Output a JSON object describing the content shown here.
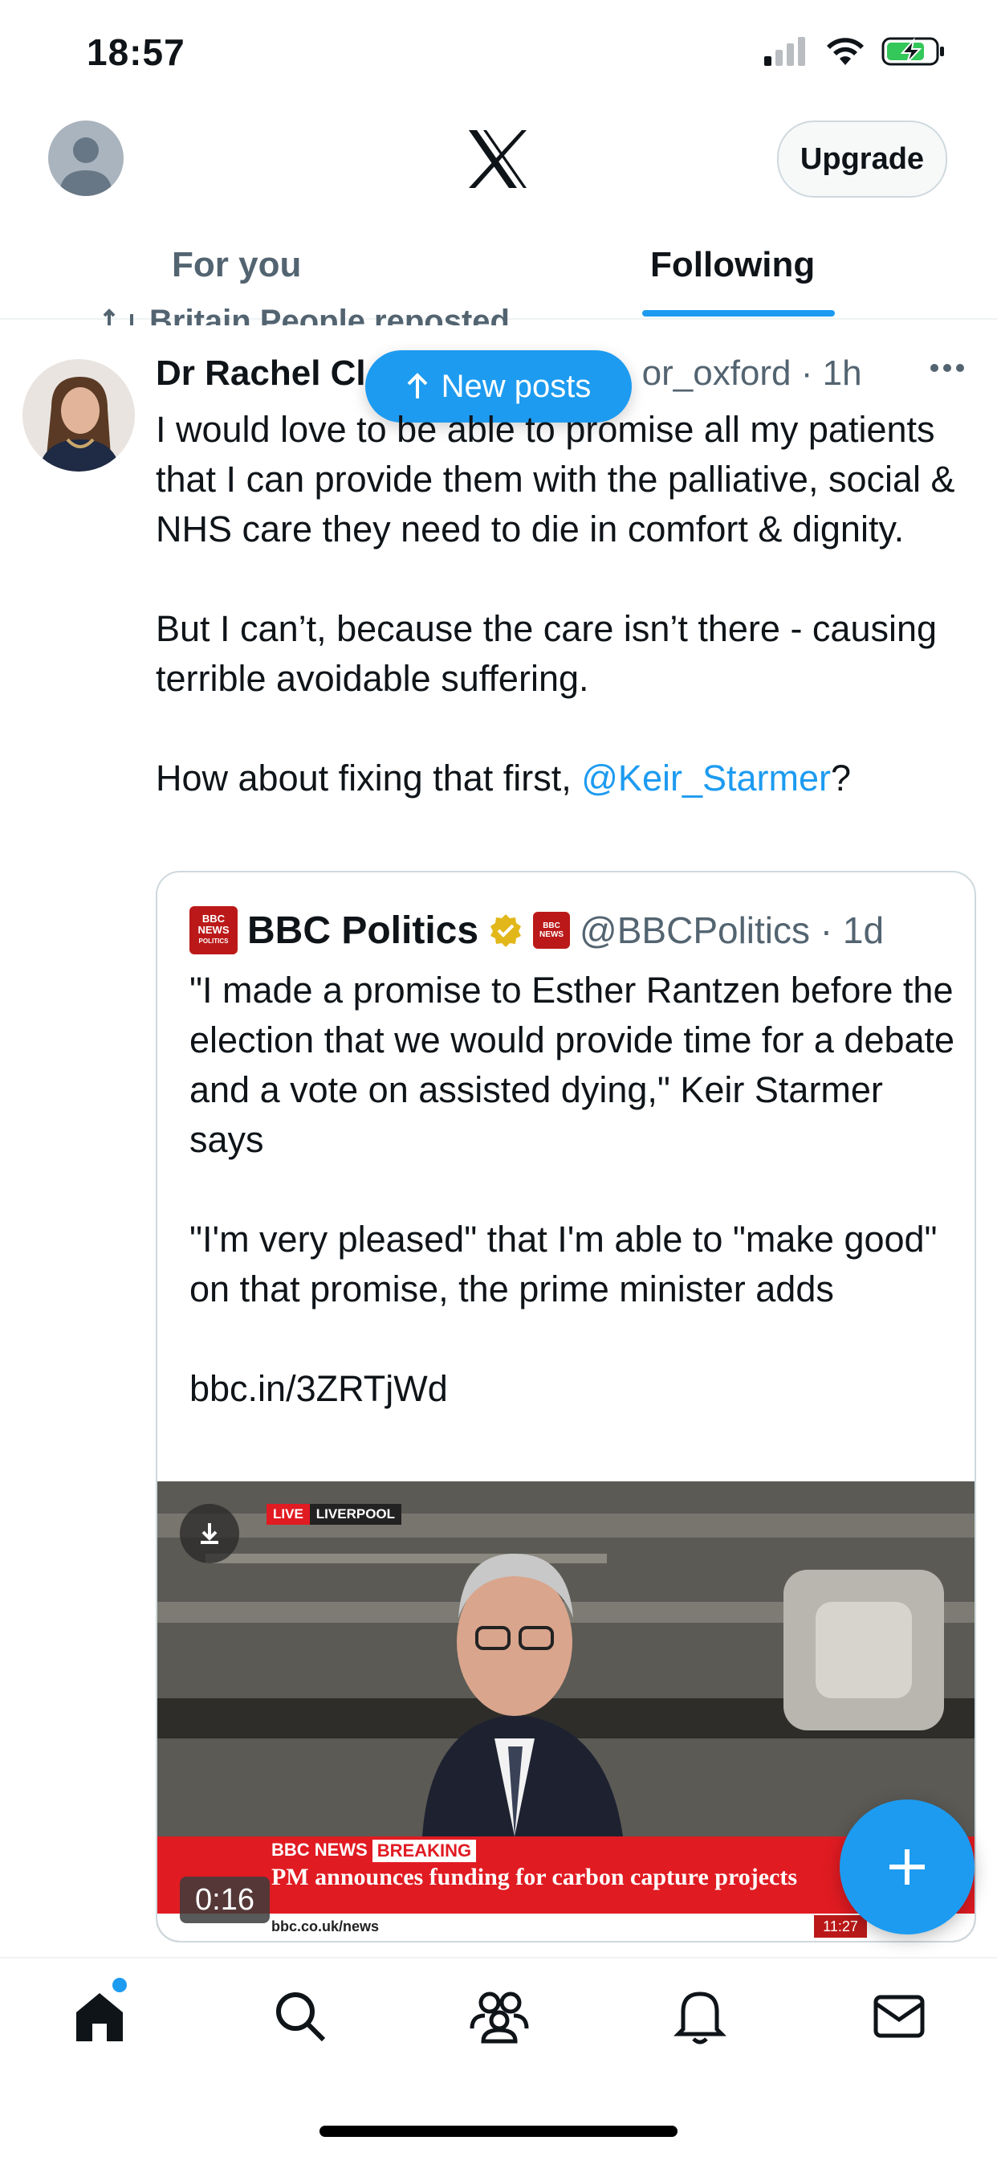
{
  "status_bar": {
    "time": "18:57"
  },
  "header": {
    "upgrade_label": "Upgrade"
  },
  "tabs": [
    {
      "label": "For you"
    },
    {
      "label": "Following"
    }
  ],
  "new_posts_label": "New posts",
  "tweet": {
    "repost_label": "Britain People reposted",
    "author_name": "Dr Rachel Cl",
    "author_handle": "or_oxford · 1h",
    "paragraphs": [
      "I would love to be able to promise all my patients that I can provide them with the palliative, social & NHS care they need to die in comfort & dignity.",
      "But I can’t, because the care isn’t there - causing terrible avoidable suffering."
    ],
    "last_paragraph_prefix": "How about fixing that first, ",
    "mention": "@Keir_Starmer",
    "last_paragraph_suffix": "?"
  },
  "quote": {
    "name": "BBC Politics",
    "handle": "@BBCPolitics · 1d",
    "logo_text": [
      "BBC",
      "NEWS",
      "POLITICS"
    ],
    "badge_text": [
      "BBC",
      "NEWS"
    ],
    "paragraphs": [
      "\"I made a promise to Esther Rantzen before the election that we would provide time for a debate and a vote on assisted dying,\" Keir Starmer says",
      "\"I'm very pleased\" that I'm able to \"make good\" on that promise, the prime minister adds",
      "bbc.in/3ZRTjWd"
    ],
    "video": {
      "live_label": "LIVE",
      "location": "LIVERPOOL",
      "network": "BBC NEWS",
      "breaking_label": "BREAKING",
      "headline": "PM announces funding for carbon capture projects",
      "ticker_url": "bbc.co.uk/news",
      "clock": "11:27",
      "duration": "0:16"
    }
  },
  "colors": {
    "accent": "#1d9bf0",
    "bbc_red": "#bb1919",
    "breaking_red": "#e11b22"
  }
}
